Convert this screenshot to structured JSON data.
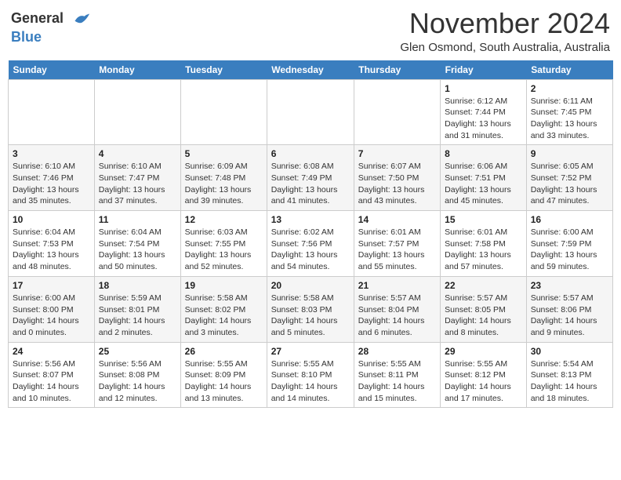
{
  "header": {
    "logo_line1": "General",
    "logo_line2": "Blue",
    "month_title": "November 2024",
    "location": "Glen Osmond, South Australia, Australia"
  },
  "weekdays": [
    "Sunday",
    "Monday",
    "Tuesday",
    "Wednesday",
    "Thursday",
    "Friday",
    "Saturday"
  ],
  "weeks": [
    [
      {
        "day": "",
        "info": ""
      },
      {
        "day": "",
        "info": ""
      },
      {
        "day": "",
        "info": ""
      },
      {
        "day": "",
        "info": ""
      },
      {
        "day": "",
        "info": ""
      },
      {
        "day": "1",
        "info": "Sunrise: 6:12 AM\nSunset: 7:44 PM\nDaylight: 13 hours and 31 minutes."
      },
      {
        "day": "2",
        "info": "Sunrise: 6:11 AM\nSunset: 7:45 PM\nDaylight: 13 hours and 33 minutes."
      }
    ],
    [
      {
        "day": "3",
        "info": "Sunrise: 6:10 AM\nSunset: 7:46 PM\nDaylight: 13 hours and 35 minutes."
      },
      {
        "day": "4",
        "info": "Sunrise: 6:10 AM\nSunset: 7:47 PM\nDaylight: 13 hours and 37 minutes."
      },
      {
        "day": "5",
        "info": "Sunrise: 6:09 AM\nSunset: 7:48 PM\nDaylight: 13 hours and 39 minutes."
      },
      {
        "day": "6",
        "info": "Sunrise: 6:08 AM\nSunset: 7:49 PM\nDaylight: 13 hours and 41 minutes."
      },
      {
        "day": "7",
        "info": "Sunrise: 6:07 AM\nSunset: 7:50 PM\nDaylight: 13 hours and 43 minutes."
      },
      {
        "day": "8",
        "info": "Sunrise: 6:06 AM\nSunset: 7:51 PM\nDaylight: 13 hours and 45 minutes."
      },
      {
        "day": "9",
        "info": "Sunrise: 6:05 AM\nSunset: 7:52 PM\nDaylight: 13 hours and 47 minutes."
      }
    ],
    [
      {
        "day": "10",
        "info": "Sunrise: 6:04 AM\nSunset: 7:53 PM\nDaylight: 13 hours and 48 minutes."
      },
      {
        "day": "11",
        "info": "Sunrise: 6:04 AM\nSunset: 7:54 PM\nDaylight: 13 hours and 50 minutes."
      },
      {
        "day": "12",
        "info": "Sunrise: 6:03 AM\nSunset: 7:55 PM\nDaylight: 13 hours and 52 minutes."
      },
      {
        "day": "13",
        "info": "Sunrise: 6:02 AM\nSunset: 7:56 PM\nDaylight: 13 hours and 54 minutes."
      },
      {
        "day": "14",
        "info": "Sunrise: 6:01 AM\nSunset: 7:57 PM\nDaylight: 13 hours and 55 minutes."
      },
      {
        "day": "15",
        "info": "Sunrise: 6:01 AM\nSunset: 7:58 PM\nDaylight: 13 hours and 57 minutes."
      },
      {
        "day": "16",
        "info": "Sunrise: 6:00 AM\nSunset: 7:59 PM\nDaylight: 13 hours and 59 minutes."
      }
    ],
    [
      {
        "day": "17",
        "info": "Sunrise: 6:00 AM\nSunset: 8:00 PM\nDaylight: 14 hours and 0 minutes."
      },
      {
        "day": "18",
        "info": "Sunrise: 5:59 AM\nSunset: 8:01 PM\nDaylight: 14 hours and 2 minutes."
      },
      {
        "day": "19",
        "info": "Sunrise: 5:58 AM\nSunset: 8:02 PM\nDaylight: 14 hours and 3 minutes."
      },
      {
        "day": "20",
        "info": "Sunrise: 5:58 AM\nSunset: 8:03 PM\nDaylight: 14 hours and 5 minutes."
      },
      {
        "day": "21",
        "info": "Sunrise: 5:57 AM\nSunset: 8:04 PM\nDaylight: 14 hours and 6 minutes."
      },
      {
        "day": "22",
        "info": "Sunrise: 5:57 AM\nSunset: 8:05 PM\nDaylight: 14 hours and 8 minutes."
      },
      {
        "day": "23",
        "info": "Sunrise: 5:57 AM\nSunset: 8:06 PM\nDaylight: 14 hours and 9 minutes."
      }
    ],
    [
      {
        "day": "24",
        "info": "Sunrise: 5:56 AM\nSunset: 8:07 PM\nDaylight: 14 hours and 10 minutes."
      },
      {
        "day": "25",
        "info": "Sunrise: 5:56 AM\nSunset: 8:08 PM\nDaylight: 14 hours and 12 minutes."
      },
      {
        "day": "26",
        "info": "Sunrise: 5:55 AM\nSunset: 8:09 PM\nDaylight: 14 hours and 13 minutes."
      },
      {
        "day": "27",
        "info": "Sunrise: 5:55 AM\nSunset: 8:10 PM\nDaylight: 14 hours and 14 minutes."
      },
      {
        "day": "28",
        "info": "Sunrise: 5:55 AM\nSunset: 8:11 PM\nDaylight: 14 hours and 15 minutes."
      },
      {
        "day": "29",
        "info": "Sunrise: 5:55 AM\nSunset: 8:12 PM\nDaylight: 14 hours and 17 minutes."
      },
      {
        "day": "30",
        "info": "Sunrise: 5:54 AM\nSunset: 8:13 PM\nDaylight: 14 hours and 18 minutes."
      }
    ]
  ]
}
